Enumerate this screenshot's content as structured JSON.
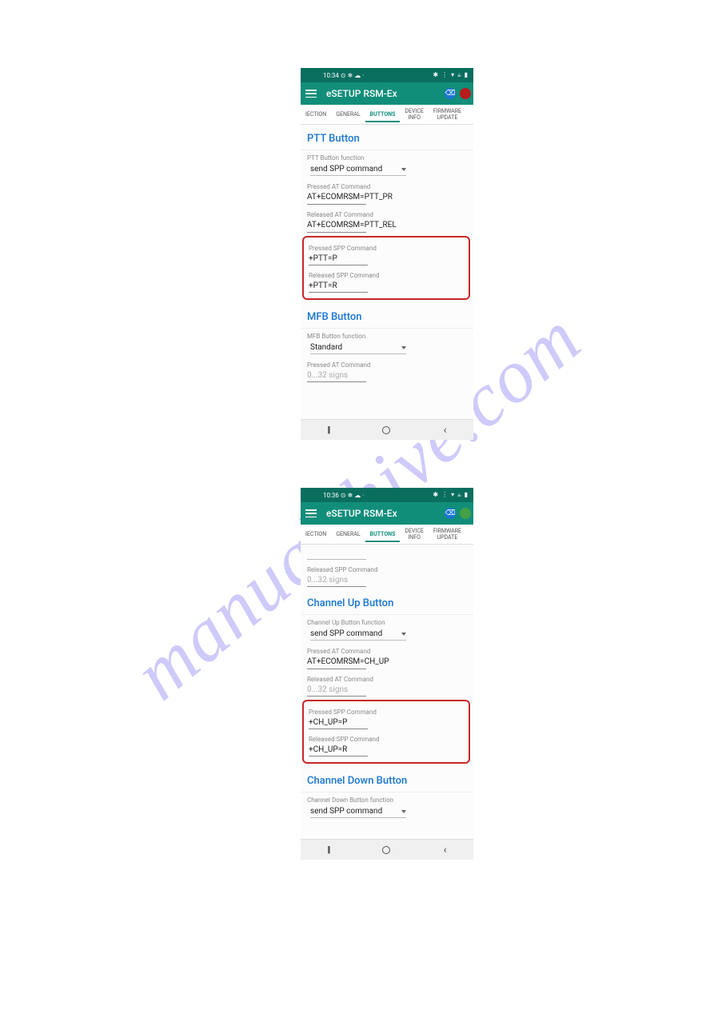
{
  "watermark": "manualshive.com",
  "screenshot1": {
    "statusbar": {
      "time": "10:34 ⊙ ❄ ☁ ·",
      "right": "✱ ⋮ ▾ ⫨ ▮"
    },
    "appbar": {
      "title": "eSETUP RSM-Ex"
    },
    "tabs": {
      "t0": "IECTION",
      "t1": "GENERAL",
      "t2": "BUTTONS",
      "t3a": "DEVICE",
      "t3b": "INFO",
      "t4a": "FIRMWARE",
      "t4b": "UPDATE"
    },
    "ptt": {
      "title": "PTT Button",
      "func_label": "PTT Button function",
      "func_value": "send SPP command",
      "pressed_at_label": "Pressed AT Command",
      "pressed_at_value": "AT+ECOMRSM=PTT_PR",
      "released_at_label": "Released AT Command",
      "released_at_value": "AT+ECOMRSM=PTT_REL",
      "pressed_spp_label": "Pressed SPP Command",
      "pressed_spp_value": "+PTT=P",
      "released_spp_label": "Released SPP Command",
      "released_spp_value": "+PTT=R"
    },
    "mfb": {
      "title": "MFB Button",
      "func_label": "MFB Button function",
      "func_value": "Standard",
      "pressed_at_label": "Pressed AT Command",
      "pressed_at_placeholder": "0...32 signs"
    }
  },
  "screenshot2": {
    "statusbar": {
      "time": "10:36 ⊙ ❄ ☁ ·",
      "right": "✱ ⋮ ▾ ⫨ ▮"
    },
    "appbar": {
      "title": "eSETUP RSM-Ex"
    },
    "tabs": {
      "t0": "IECTION",
      "t1": "GENERAL",
      "t2": "BUTTONS",
      "t3a": "DEVICE",
      "t3b": "INFO",
      "t4a": "FIRMWARE",
      "t4b": "UPDATE"
    },
    "top": {
      "released_spp_label": "Released SPP Command",
      "released_spp_placeholder": "0...32 signs"
    },
    "chup": {
      "title": "Channel Up Button",
      "func_label": "Channel Up Button function",
      "func_value": "send SPP command",
      "pressed_at_label": "Pressed AT Command",
      "pressed_at_value": "AT+ECOMRSM=CH_UP",
      "released_at_label": "Released AT Command",
      "released_at_placeholder": "0...32 signs",
      "pressed_spp_label": "Pressed SPP Command",
      "pressed_spp_value": "+CH_UP=P",
      "released_spp_label": "Released SPP Command",
      "released_spp_value": "+CH_UP=R"
    },
    "chdown": {
      "title": "Channel Down Button",
      "func_label": "Channel Down Button function",
      "func_value": "send SPP command"
    }
  }
}
